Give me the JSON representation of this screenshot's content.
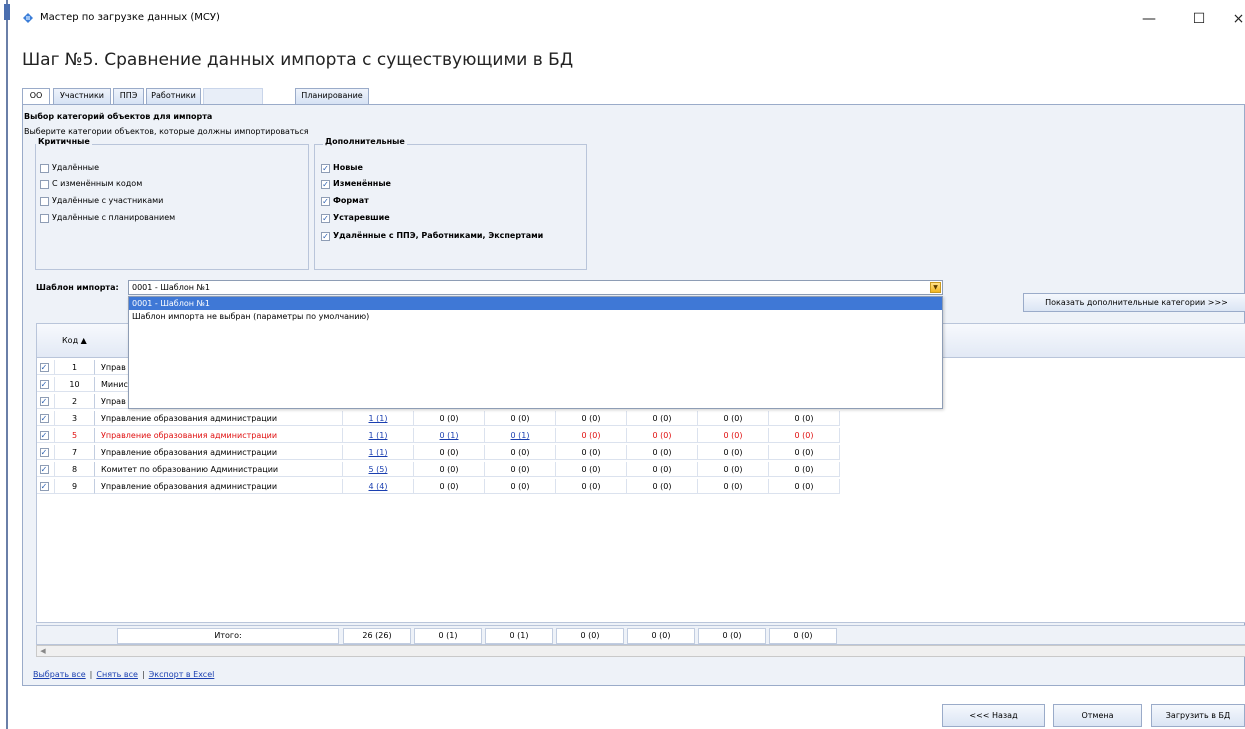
{
  "window": {
    "title": "Мастер по загрузке данных (МСУ)",
    "minimize": "—",
    "maximize": "☐",
    "close": "×"
  },
  "step_title": "Шаг №5. Сравнение данных импорта с существующими в БД",
  "tabs": [
    {
      "label": "ОО"
    },
    {
      "label": "Участники"
    },
    {
      "label": "ППЭ"
    },
    {
      "label": "Работники"
    },
    {
      "label": ""
    },
    {
      "label": "Планирование"
    }
  ],
  "section": {
    "title": "Выбор категорий объектов для импорта",
    "subtitle": "Выберите категории объектов, которые должны импортироваться"
  },
  "critical": {
    "title": "Критичные",
    "items": [
      {
        "label": "Удалённые",
        "checked": false
      },
      {
        "label": "С изменённым кодом",
        "checked": false
      },
      {
        "label": "Удалённые с участниками",
        "checked": false
      },
      {
        "label": "Удалённые с планированием",
        "checked": false
      }
    ]
  },
  "additional": {
    "title": "Дополнительные",
    "items": [
      {
        "label": "Новые",
        "checked": true
      },
      {
        "label": "Изменённые",
        "checked": true
      },
      {
        "label": "Формат",
        "checked": true
      },
      {
        "label": "Устаревшие",
        "checked": true
      },
      {
        "label": "Удалённые с ППЭ, Работниками, Экспертами",
        "checked": true
      }
    ]
  },
  "template": {
    "label": "Шаблон импорта:",
    "value": "0001 - Шаблон №1",
    "options": [
      "0001 - Шаблон №1",
      "Шаблон импорта не выбран (параметры по умолчанию)"
    ]
  },
  "more_button": "Показать дополнительные категории >>>",
  "grid": {
    "header_code": "Код ▲",
    "rows": [
      {
        "code": "1",
        "name": "Управ",
        "cols": []
      },
      {
        "code": "10",
        "name": "Минис",
        "cols": []
      },
      {
        "code": "2",
        "name": "Управ",
        "cols": []
      },
      {
        "code": "3",
        "name": "Управление образования администрации",
        "cols": [
          "1 (1)",
          "0 (0)",
          "0 (0)",
          "0 (0)",
          "0 (0)",
          "0 (0)",
          "0 (0)"
        ]
      },
      {
        "code": "5",
        "name": "Управление образования администрации",
        "cols": [
          "1 (1)",
          "0 (1)",
          "0 (1)",
          "0 (0)",
          "0 (0)",
          "0 (0)",
          "0 (0)"
        ],
        "red": true
      },
      {
        "code": "7",
        "name": "Управление образования администрации",
        "cols": [
          "1 (1)",
          "0 (0)",
          "0 (0)",
          "0 (0)",
          "0 (0)",
          "0 (0)",
          "0 (0)"
        ]
      },
      {
        "code": "8",
        "name": "Комитет по образованию Администрации",
        "cols": [
          "5 (5)",
          "0 (0)",
          "0 (0)",
          "0 (0)",
          "0 (0)",
          "0 (0)",
          "0 (0)"
        ]
      },
      {
        "code": "9",
        "name": "Управление образования администрации",
        "cols": [
          "4 (4)",
          "0 (0)",
          "0 (0)",
          "0 (0)",
          "0 (0)",
          "0 (0)",
          "0 (0)"
        ]
      }
    ],
    "total_label": "Итого:",
    "totals": [
      "26 (26)",
      "0 (1)",
      "0 (1)",
      "0 (0)",
      "0 (0)",
      "0 (0)",
      "0 (0)"
    ]
  },
  "footer_links": {
    "select_all": "Выбрать все",
    "deselect_all": "Снять все",
    "export": "Экспорт в Excel",
    "separator": "|"
  },
  "buttons": {
    "back": "<<< Назад",
    "cancel": "Отмена",
    "load": "Загрузить в БД"
  },
  "colors": {
    "accent": "#3f78d6",
    "link": "#1a3fb0",
    "error_row": "#e01010",
    "panel": "#eef2f8"
  }
}
